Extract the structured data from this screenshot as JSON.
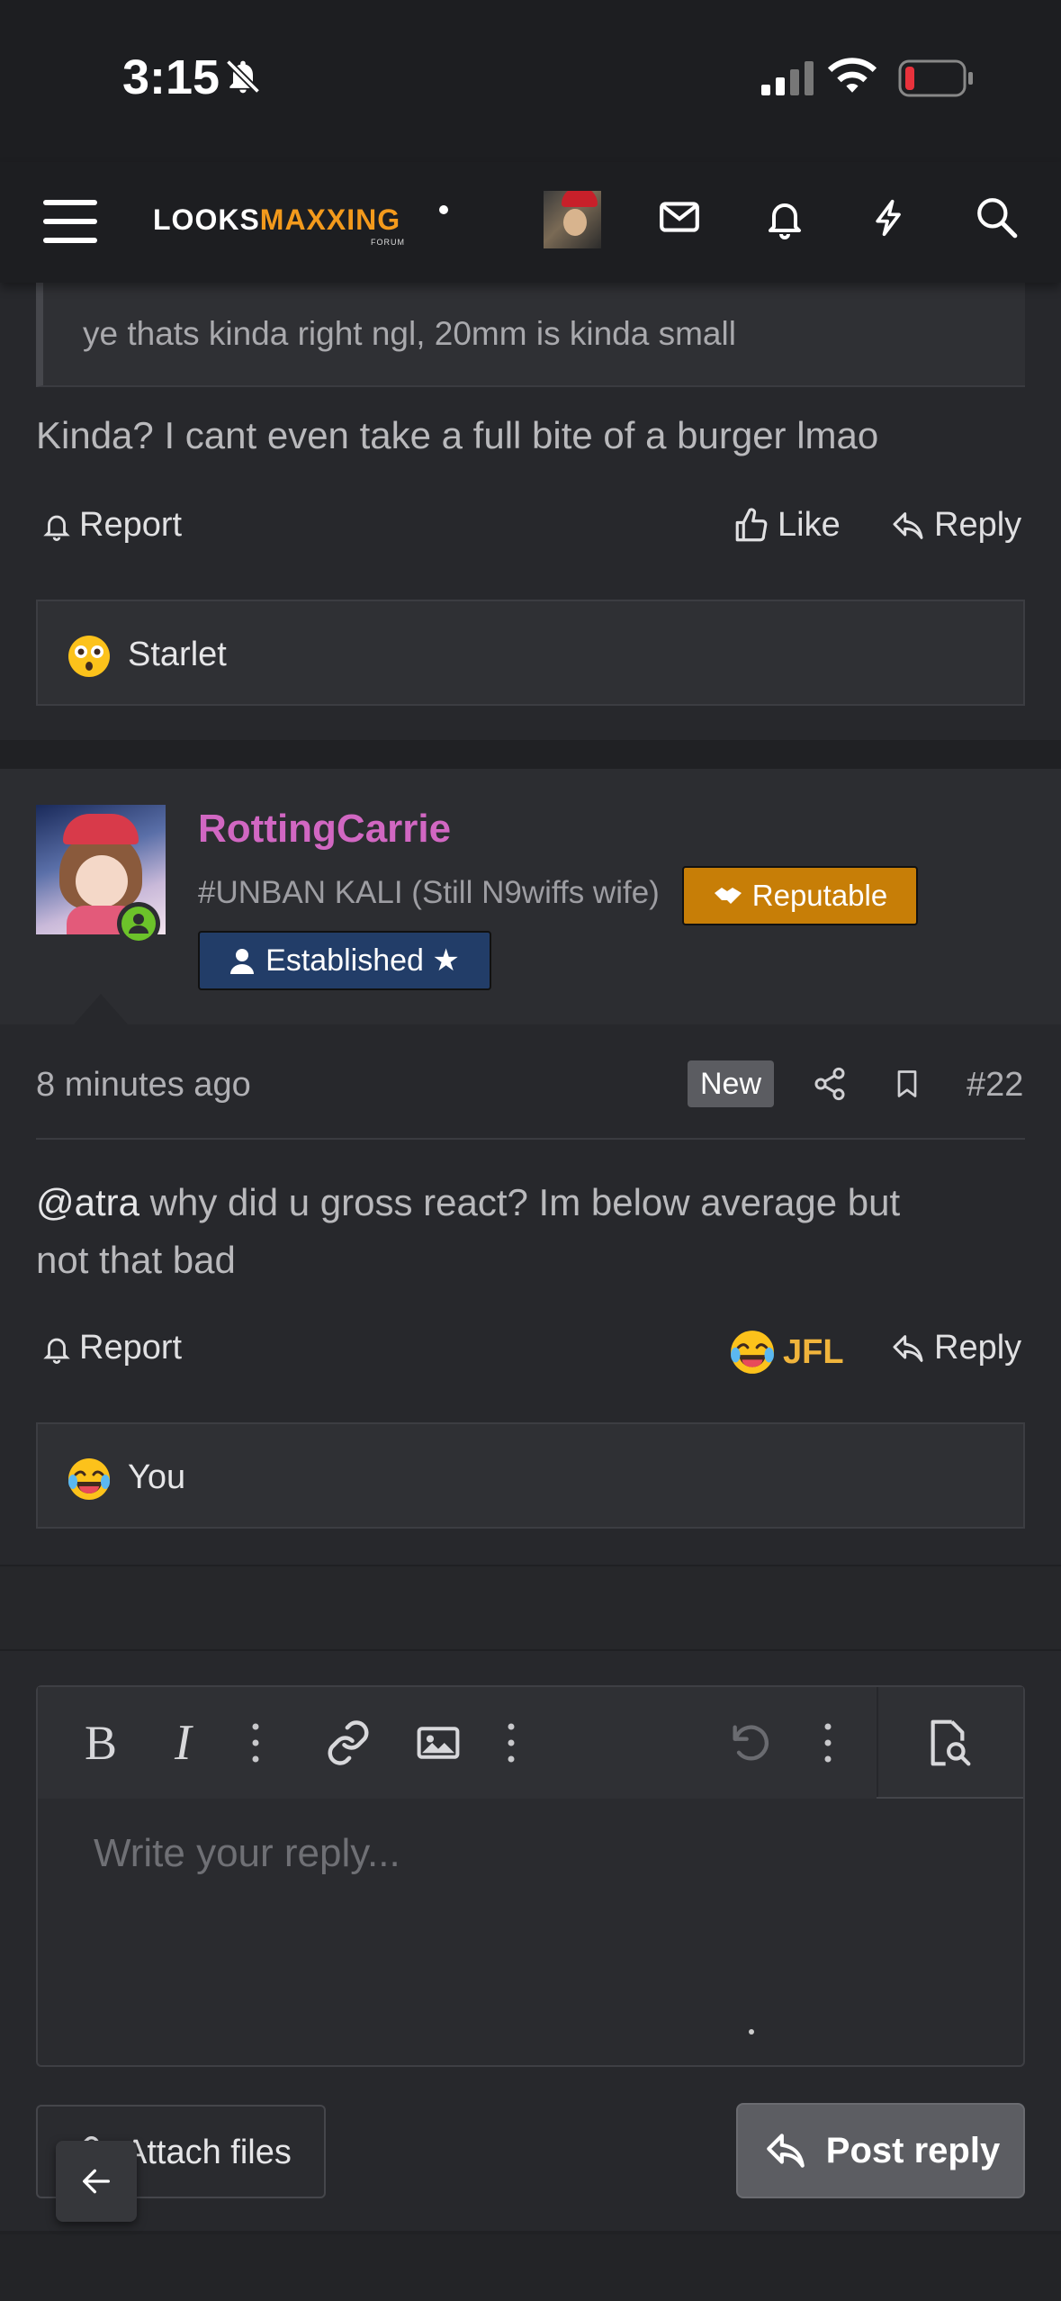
{
  "status_bar": {
    "time": "3:15"
  },
  "nav": {
    "logo_part1": "LOOKS",
    "logo_part2": "MAXXING",
    "logo_sub": "FORUM"
  },
  "previous_post": {
    "quote_text": "ye thats kinda right ngl, 20mm is kinda small",
    "body": "Kinda? I cant even take a full bite of a burger lmao",
    "report_label": "Report",
    "like_label": "Like",
    "reply_label": "Reply",
    "reaction_user": "Starlet"
  },
  "post": {
    "username": "RottingCarrie",
    "user_title": "#UNBAN KALI (Still N9wiffs wife)",
    "badge_reputable": "Reputable",
    "badge_established": "Established ★",
    "time_ago": "8 minutes ago",
    "new_badge": "New",
    "post_number": "#22",
    "mention": "@atra",
    "body_line1": " why did u gross react? Im below average but",
    "body_line2": "not that bad",
    "report_label": "Report",
    "reaction_label": "JFL",
    "reply_label": "Reply",
    "reaction_user": "You"
  },
  "editor": {
    "placeholder": "Write your reply...",
    "attach_label": "Attach files",
    "post_reply_label": "Post reply"
  },
  "colors": {
    "username": "#d167c2",
    "reputable_badge": "#c77e07",
    "established_badge": "#223d68",
    "jfl": "#f0b43c",
    "online": "#6cc22a"
  }
}
